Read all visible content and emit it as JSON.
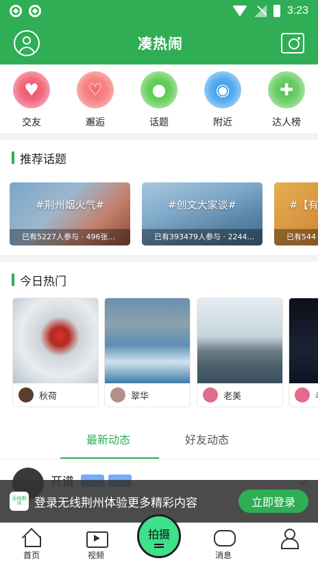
{
  "status_bar": {
    "time": "3:23"
  },
  "header": {
    "title": "凑热闹"
  },
  "categories": [
    {
      "label": "交友",
      "icon": "heart-icon"
    },
    {
      "label": "邂逅",
      "icon": "hands-heart-icon"
    },
    {
      "label": "话题",
      "icon": "planet-icon"
    },
    {
      "label": "附近",
      "icon": "location-pin-icon"
    },
    {
      "label": "达人榜",
      "icon": "target-person-icon"
    }
  ],
  "recommended_topics": {
    "title": "推荐话题",
    "items": [
      {
        "title": "#荆州烟火气#",
        "meta": "已有5227人参与 · 496张..."
      },
      {
        "title": "#创文大家谈#",
        "meta": "已有393479人参与 · 2244..."
      },
      {
        "title": "#【有",
        "meta": "已有544"
      }
    ]
  },
  "today_hot": {
    "title": "今日热门",
    "items": [
      {
        "author": "秋荷"
      },
      {
        "author": "翠华"
      },
      {
        "author": "老美"
      },
      {
        "author": "老"
      }
    ]
  },
  "feed_tabs": {
    "latest": "最新动态",
    "friends": "好友动态"
  },
  "feed": {
    "first_author": "开谱"
  },
  "login_banner": {
    "logo_text": "无线荆州",
    "text": "登录无线荆州体验更多精彩内容",
    "button": "立即登录"
  },
  "bottom_nav": {
    "home": "首页",
    "video": "视频",
    "shoot": "拍摄",
    "message": "消息",
    "me": ""
  },
  "colors": {
    "brand_green": "#2fae55",
    "shoot_button": "#3ee08a"
  }
}
